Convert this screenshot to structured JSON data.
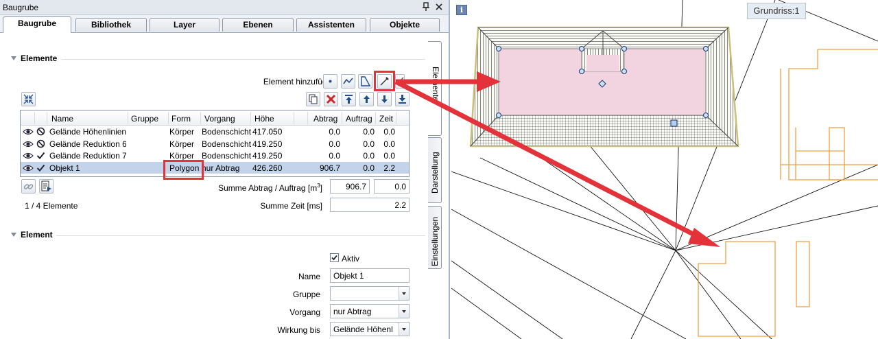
{
  "window": {
    "title": "Baugrube",
    "pin_icon": "pin-icon",
    "close_icon": "close-icon"
  },
  "tabs": [
    {
      "label": "Baugrube",
      "active": true
    },
    {
      "label": "Bibliothek"
    },
    {
      "label": "Layer"
    },
    {
      "label": "Ebenen"
    },
    {
      "label": "Assistenten"
    },
    {
      "label": "Objekte"
    }
  ],
  "side_tabs": [
    {
      "label": "Elemente",
      "active": true
    },
    {
      "label": "Darstellung"
    },
    {
      "label": "Einstellungen"
    }
  ],
  "elements_section": {
    "title": "Elemente",
    "add_label": "Element hinzufügen",
    "add_buttons": [
      "point-icon",
      "polyline-icon",
      "polygon-icon",
      "pipette-icon",
      "pen-icon"
    ],
    "toolbar": [
      "copy-icon",
      "delete-icon",
      "move-top-icon",
      "move-up-icon",
      "move-down-icon",
      "move-bottom-icon"
    ],
    "table": {
      "columns": [
        "Name",
        "Gruppe",
        "Form",
        "Vorgang",
        "Höhe",
        "Abtrag",
        "Auftrag",
        "Zeit"
      ],
      "rows": [
        {
          "vis": "eye-icon",
          "state": "no-icon",
          "name": "Gelände Höhenlinien",
          "gruppe": "",
          "form": "Körper",
          "vorgang": "Bodenschicht",
          "hoehe": "417.050",
          "abtrag": "0.0",
          "auftrag": "0.0",
          "zeit": "0.0"
        },
        {
          "vis": "eye-icon",
          "state": "no-icon",
          "name": "Gelände Reduktion 6",
          "gruppe": "",
          "form": "Körper",
          "vorgang": "Bodenschicht",
          "hoehe": "419.250",
          "abtrag": "0.0",
          "auftrag": "0.0",
          "zeit": "0.0"
        },
        {
          "vis": "eye-icon",
          "state": "check-icon",
          "name": "Gelände Reduktion 7",
          "gruppe": "",
          "form": "Körper",
          "vorgang": "Bodenschicht",
          "hoehe": "419.250",
          "abtrag": "0.0",
          "auftrag": "0.0",
          "zeit": "0.0"
        },
        {
          "vis": "eye-icon",
          "state": "check-icon",
          "name": "Objekt 1",
          "gruppe": "",
          "form": "Polygon",
          "vorgang": "nur Abtrag",
          "hoehe": "426.260",
          "abtrag": "906.7",
          "auftrag": "0.0",
          "zeit": "2.2",
          "selected": true
        }
      ]
    },
    "summe_label": "Summe Abtrag / Auftrag [m",
    "summe_sup": "3",
    "summe_end": "]",
    "summe_abtrag": "906.7",
    "summe_auftrag": "0.0",
    "zeit_label": "Summe Zeit [ms]",
    "zeit_value": "2.2",
    "count": "1 / 4 Elemente"
  },
  "element_section": {
    "title": "Element",
    "aktiv_label": "Aktiv",
    "aktiv_checked": true,
    "name_label": "Name",
    "name_value": "Objekt 1",
    "gruppe_label": "Gruppe",
    "gruppe_value": "",
    "vorgang_label": "Vorgang",
    "vorgang_value": "nur Abtrag",
    "wirkung_label": "Wirkung bis",
    "wirkung_value": "Gelände Höhenl"
  },
  "canvas": {
    "info": "i",
    "view_label": "Grundriss:1",
    "colors": {
      "pink": "#f1d4df",
      "orange": "#f0a040",
      "highlight": "#e3323a",
      "hatch_border": "#c8c07a"
    }
  }
}
